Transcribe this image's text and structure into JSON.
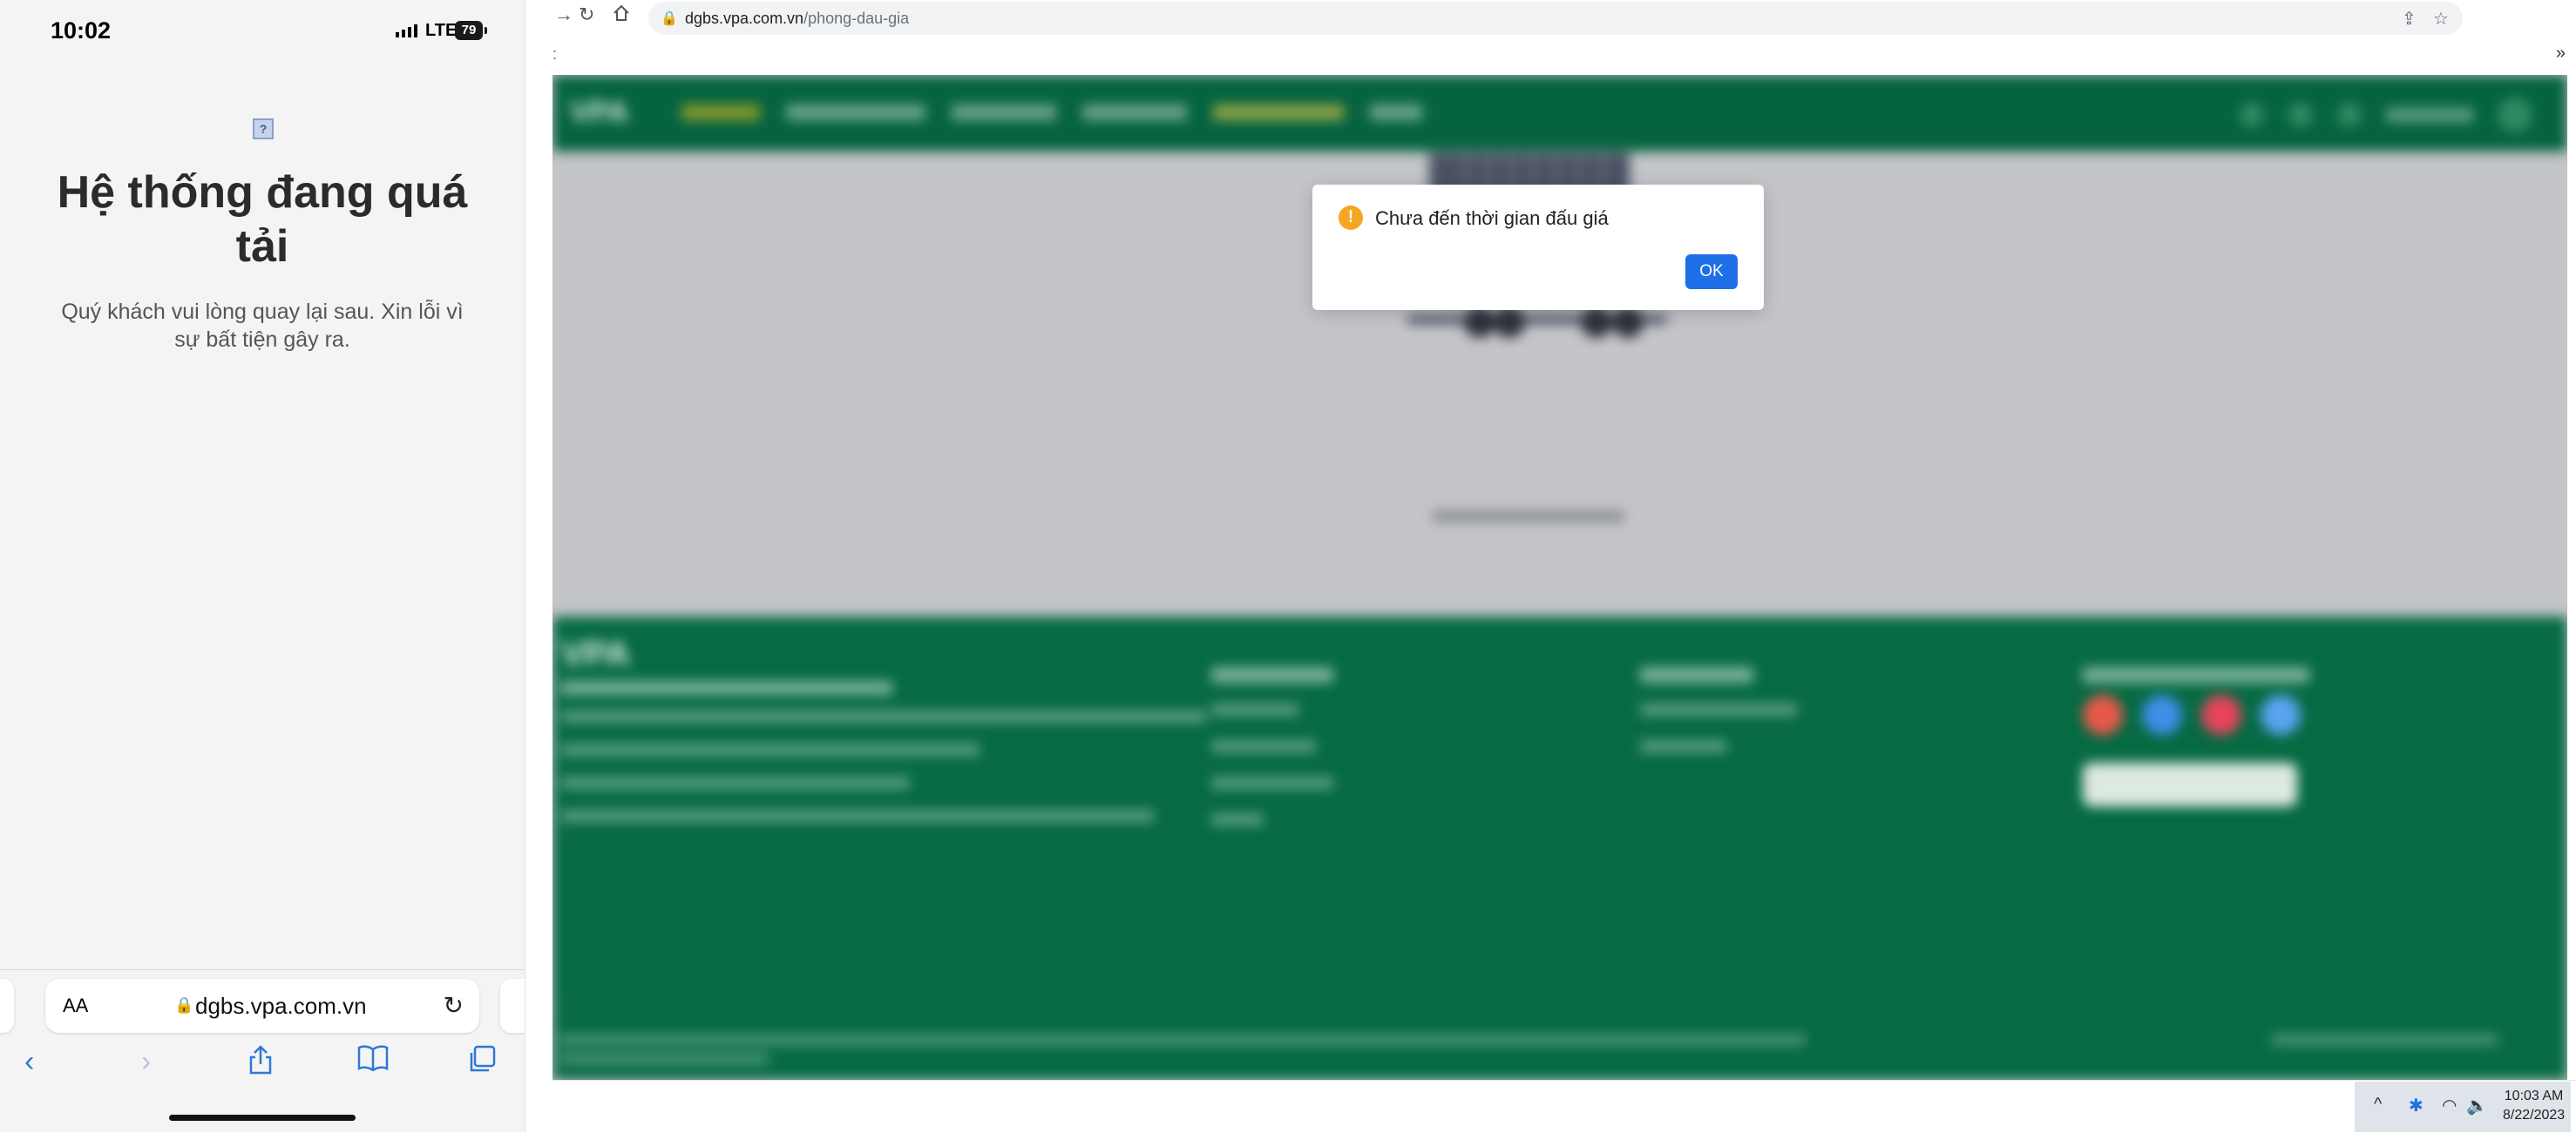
{
  "phone": {
    "time": "10:02",
    "network": "LTE",
    "battery": "79",
    "broken_image_glyph": "?",
    "title": "Hệ thống đang quá tải",
    "subtitle": "Quý khách vui lòng quay lại sau. Xin lỗi vì sự bất tiện gây ra.",
    "address_bar": {
      "text_size_label": "AA",
      "url": "dgbs.vpa.com.vn"
    },
    "toolbar_icons": [
      "back-icon",
      "forward-icon",
      "share-icon",
      "bookmarks-icon",
      "tabs-icon"
    ]
  },
  "browser": {
    "url_host": "dgbs.vpa.com.vn",
    "url_path": "/phong-dau-gia",
    "bookmarks_overflow": "»"
  },
  "dialog": {
    "message": "Chưa đến thời gian đấu giá",
    "ok_label": "OK",
    "icon_glyph": "!"
  },
  "site": {
    "logo": "VPA",
    "colors": {
      "header": "#056340",
      "footer": "#066a42",
      "dialog_button": "#1e6fe8",
      "warning": "#f5a623"
    }
  },
  "taskbar": {
    "time": "10:03 AM",
    "date": "8/22/2023"
  }
}
